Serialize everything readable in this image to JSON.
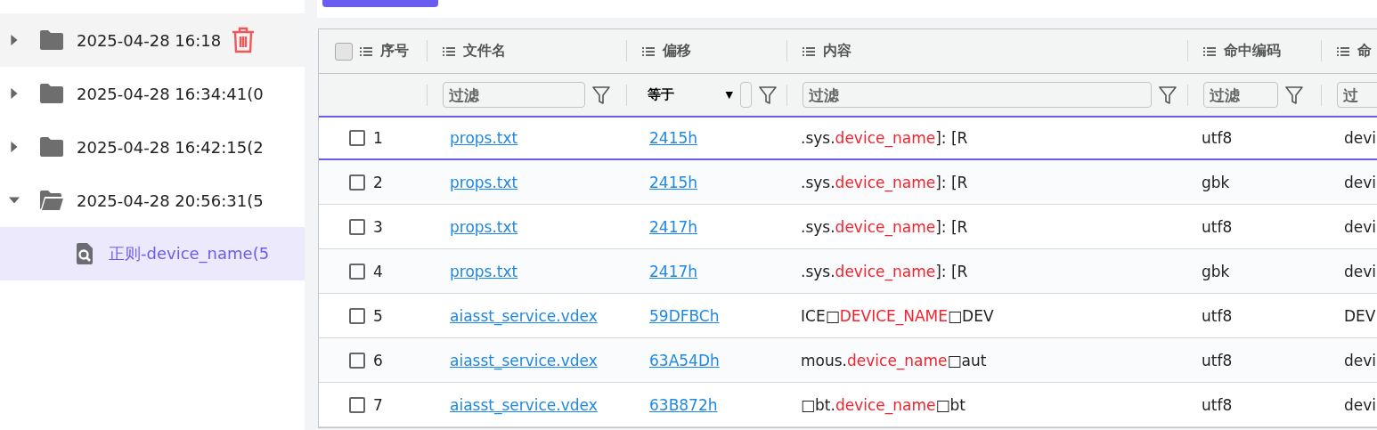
{
  "sidebar": {
    "tree": [
      {
        "label": "2025-04-28 16:18",
        "expanded": false,
        "hovered": true
      },
      {
        "label": "2025-04-28 16:34:41(0",
        "expanded": false,
        "hovered": false
      },
      {
        "label": "2025-04-28 16:42:15(2",
        "expanded": false,
        "hovered": false
      },
      {
        "label": "2025-04-28 20:56:31(5",
        "expanded": true,
        "hovered": false,
        "children": [
          {
            "label": "正则-device_name(5",
            "selected": true
          }
        ]
      }
    ]
  },
  "table": {
    "select_all": {
      "checked": false
    },
    "columns": [
      {
        "label": "序号",
        "filter": {
          "kind": "none"
        }
      },
      {
        "label": "文件名",
        "filter": {
          "kind": "text",
          "placeholder": "过滤"
        }
      },
      {
        "label": "偏移",
        "filter": {
          "kind": "select",
          "value": "等于",
          "caret": "▼"
        }
      },
      {
        "label": "内容",
        "filter": {
          "kind": "text",
          "placeholder": "过滤"
        }
      },
      {
        "label": "命中编码",
        "filter": {
          "kind": "text",
          "placeholder": "过滤"
        }
      },
      {
        "label": "命",
        "filter": {
          "kind": "text",
          "placeholder": "过"
        }
      }
    ],
    "rows": [
      {
        "index": "1",
        "checked": false,
        "selected": true,
        "file": "props.txt",
        "offset": "2415h",
        "content": [
          {
            "text": ".sys.",
            "hit": false
          },
          {
            "text": "device_name",
            "hit": true
          },
          {
            "text": "]: [R",
            "hit": false
          }
        ],
        "encoding": "utf8",
        "column_6": "devi"
      },
      {
        "index": "2",
        "checked": false,
        "selected": false,
        "file": "props.txt",
        "offset": "2415h",
        "content": [
          {
            "text": ".sys.",
            "hit": false
          },
          {
            "text": "device_name",
            "hit": true
          },
          {
            "text": "]: [R",
            "hit": false
          }
        ],
        "encoding": "gbk",
        "column_6": "devi"
      },
      {
        "index": "3",
        "checked": false,
        "selected": false,
        "file": "props.txt",
        "offset": "2417h",
        "content": [
          {
            "text": ".sys.",
            "hit": false
          },
          {
            "text": "device_name",
            "hit": true
          },
          {
            "text": "]: [R",
            "hit": false
          }
        ],
        "encoding": "utf8",
        "column_6": "devi"
      },
      {
        "index": "4",
        "checked": false,
        "selected": false,
        "file": "props.txt",
        "offset": "2417h",
        "content": [
          {
            "text": ".sys.",
            "hit": false
          },
          {
            "text": "device_name",
            "hit": true
          },
          {
            "text": "]: [R",
            "hit": false
          }
        ],
        "encoding": "gbk",
        "column_6": "devi"
      },
      {
        "index": "5",
        "checked": false,
        "selected": false,
        "file": "aiasst_service.vdex",
        "offset": "59DFBCh",
        "content": [
          {
            "text": "ICE□",
            "hit": false
          },
          {
            "text": "DEVICE_NAME",
            "hit": true
          },
          {
            "text": "□DEV",
            "hit": false
          }
        ],
        "encoding": "utf8",
        "column_6": "DEV"
      },
      {
        "index": "6",
        "checked": false,
        "selected": false,
        "file": "aiasst_service.vdex",
        "offset": "63A54Dh",
        "content": [
          {
            "text": "mous.",
            "hit": false
          },
          {
            "text": "device_name",
            "hit": true
          },
          {
            "text": "□aut",
            "hit": false
          }
        ],
        "encoding": "utf8",
        "column_6": "devi"
      },
      {
        "index": "7",
        "checked": false,
        "selected": false,
        "file": "aiasst_service.vdex",
        "offset": "63B872h",
        "content": [
          {
            "text": "□bt.",
            "hit": false
          },
          {
            "text": "device_name",
            "hit": true
          },
          {
            "text": "□bt",
            "hit": false
          }
        ],
        "encoding": "utf8",
        "column_6": "devi"
      }
    ]
  }
}
